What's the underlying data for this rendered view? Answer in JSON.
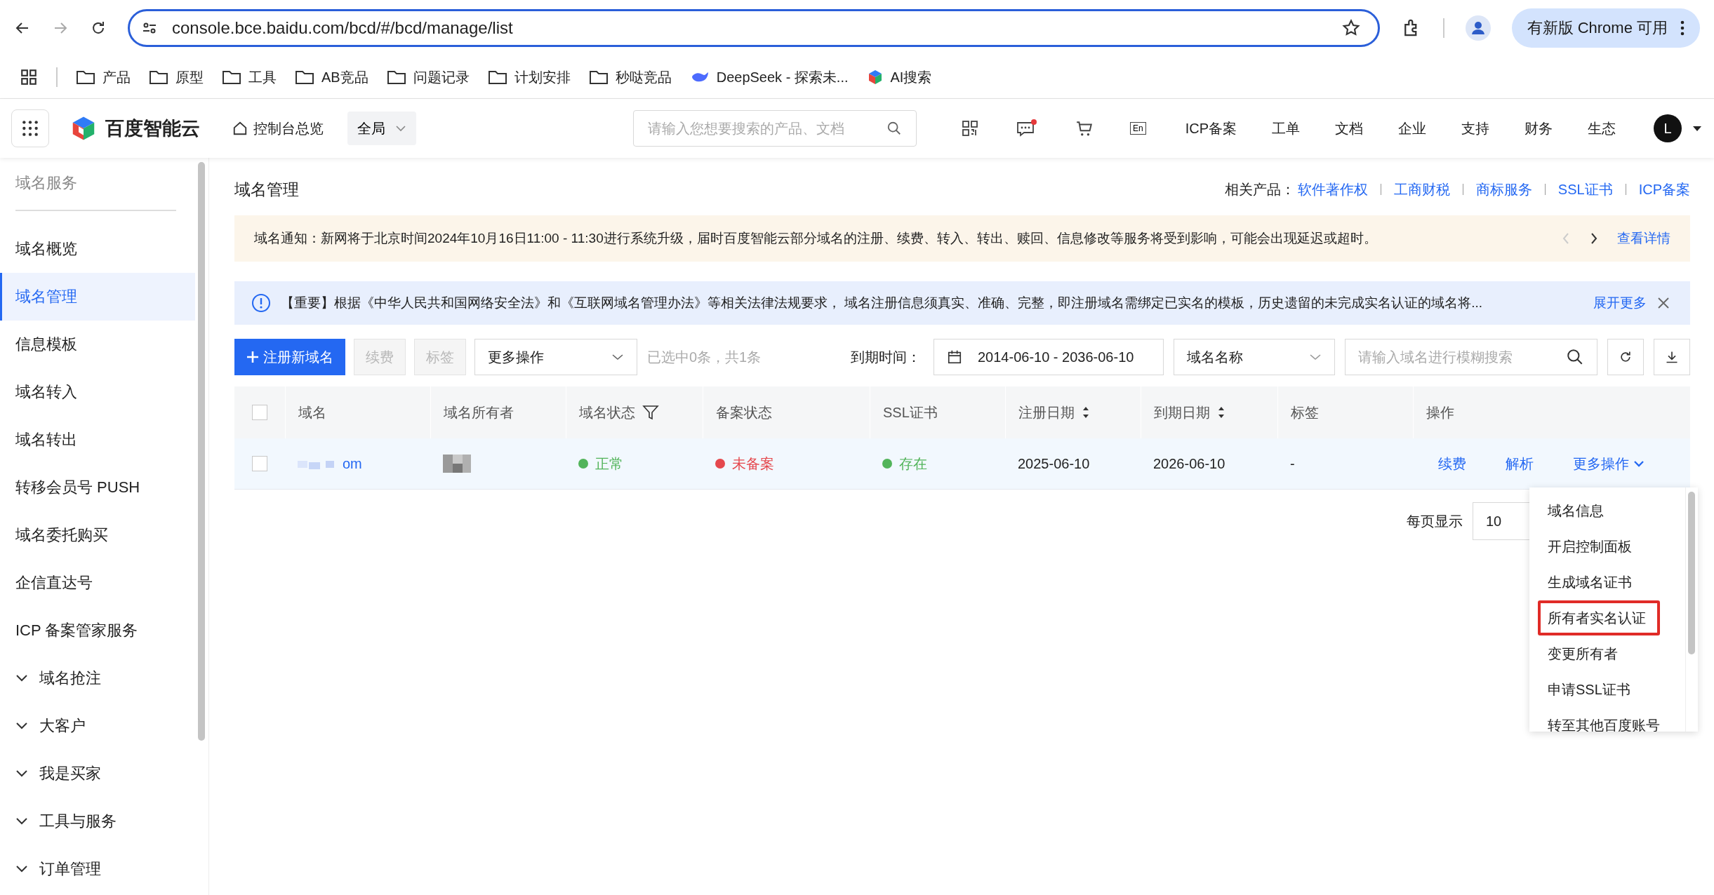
{
  "browser": {
    "url": "console.bce.baidu.com/bcd/#/bcd/manage/list",
    "update_button": "有新版 Chrome 可用",
    "bookmarks": [
      {
        "label": "产品",
        "kind": "folder"
      },
      {
        "label": "原型",
        "kind": "folder"
      },
      {
        "label": "工具",
        "kind": "folder"
      },
      {
        "label": "AB竞品",
        "kind": "folder"
      },
      {
        "label": "问题记录",
        "kind": "folder"
      },
      {
        "label": "计划安排",
        "kind": "folder"
      },
      {
        "label": "秒哒竞品",
        "kind": "folder"
      },
      {
        "label": "DeepSeek - 探索未...",
        "kind": "whale"
      },
      {
        "label": "AI搜索",
        "kind": "cube"
      }
    ]
  },
  "header": {
    "brand": "百度智能云",
    "overview": "控制台总览",
    "region": "全局",
    "search_placeholder": "请输入您想要搜索的产品、文档",
    "lang": "En",
    "links": [
      "ICP备案",
      "工单",
      "文档",
      "企业",
      "支持",
      "财务",
      "生态"
    ],
    "avatar": "L"
  },
  "sidebar": {
    "title": "域名服务",
    "items": [
      {
        "label": "域名概览",
        "kind": "link",
        "selected": false
      },
      {
        "label": "域名管理",
        "kind": "link",
        "selected": true
      },
      {
        "label": "信息模板",
        "kind": "link",
        "selected": false
      },
      {
        "label": "域名转入",
        "kind": "link",
        "selected": false
      },
      {
        "label": "域名转出",
        "kind": "link",
        "selected": false
      },
      {
        "label": "转移会员号 PUSH",
        "kind": "link",
        "selected": false
      },
      {
        "label": "域名委托购买",
        "kind": "link",
        "selected": false
      },
      {
        "label": "企信直达号",
        "kind": "link",
        "selected": false
      },
      {
        "label": "ICP 备案管家服务",
        "kind": "link",
        "selected": false
      },
      {
        "label": "域名抢注",
        "kind": "group",
        "selected": false
      },
      {
        "label": "大客户",
        "kind": "group",
        "selected": false
      },
      {
        "label": "我是买家",
        "kind": "group",
        "selected": false
      },
      {
        "label": "工具与服务",
        "kind": "group",
        "selected": false
      },
      {
        "label": "订单管理",
        "kind": "group",
        "selected": false
      }
    ]
  },
  "page": {
    "title": "域名管理",
    "related_label": "相关产品：",
    "related": [
      "软件著作权",
      "工商财税",
      "商标服务",
      "SSL证书",
      "ICP备案"
    ]
  },
  "notice": {
    "text": "域名通知：新网将于北京时间2024年10月16日11:00 - 11:30进行系统升级，届时百度智能云部分域名的注册、续费、转入、转出、赎回、信息修改等服务将受到影响，可能会出现延迟或超时。",
    "link": "查看详情"
  },
  "alert": {
    "text": "【重要】根据《中华人民共和国网络安全法》和《互联网域名管理办法》等相关法律法规要求， 域名注册信息须真实、准确、完整，即注册域名需绑定已实名的模板，历史遗留的未完成实名认证的域名将...",
    "link": "展开更多"
  },
  "toolbar": {
    "buttons": [
      {
        "label": "注册新域名",
        "kind": "primary",
        "disabled": false
      },
      {
        "label": "续费",
        "kind": "default",
        "disabled": true
      },
      {
        "label": "标签",
        "kind": "default",
        "disabled": true
      }
    ],
    "more_select": "更多操作",
    "selection_info": "已选中0条，共1条",
    "date_label": "到期时间：",
    "date_range": "2014-06-10 - 2036-06-10",
    "field_select": "域名名称",
    "search_placeholder": "请输入域名进行模糊搜索"
  },
  "table": {
    "all_checked": false,
    "columns": [
      {
        "label": "域名",
        "kind": "plain"
      },
      {
        "label": "域名所有者",
        "kind": "plain"
      },
      {
        "label": "域名状态",
        "kind": "filter"
      },
      {
        "label": "备案状态",
        "kind": "plain"
      },
      {
        "label": "SSL证书",
        "kind": "plain"
      },
      {
        "label": "注册日期",
        "kind": "sort"
      },
      {
        "label": "到期日期",
        "kind": "sort"
      },
      {
        "label": "标签",
        "kind": "plain"
      },
      {
        "label": "操作",
        "kind": "plain"
      }
    ],
    "rows": [
      {
        "checked": false,
        "domain": "om",
        "status": {
          "text": "正常",
          "color": "#52b45a"
        },
        "icp": {
          "text": "未备案",
          "color": "#e5484d"
        },
        "ssl": {
          "text": "存在",
          "color": "#52b45a"
        },
        "registered": "2025-06-10",
        "expires": "2026-06-10",
        "tags": "-",
        "actions": [
          "续费",
          "解析",
          "更多操作"
        ]
      }
    ]
  },
  "pagination": {
    "label": "每页显示",
    "page_size": "10"
  },
  "dropdown": {
    "items": [
      {
        "label": "域名信息",
        "outlined": false
      },
      {
        "label": "开启控制面板",
        "outlined": false
      },
      {
        "label": "生成域名证书",
        "outlined": false
      },
      {
        "label": "所有者实名认证",
        "outlined": true
      },
      {
        "label": "变更所有者",
        "outlined": false
      },
      {
        "label": "申请SSL证书",
        "outlined": false
      },
      {
        "label": "转至其他百度账号",
        "outlined": false
      }
    ]
  }
}
